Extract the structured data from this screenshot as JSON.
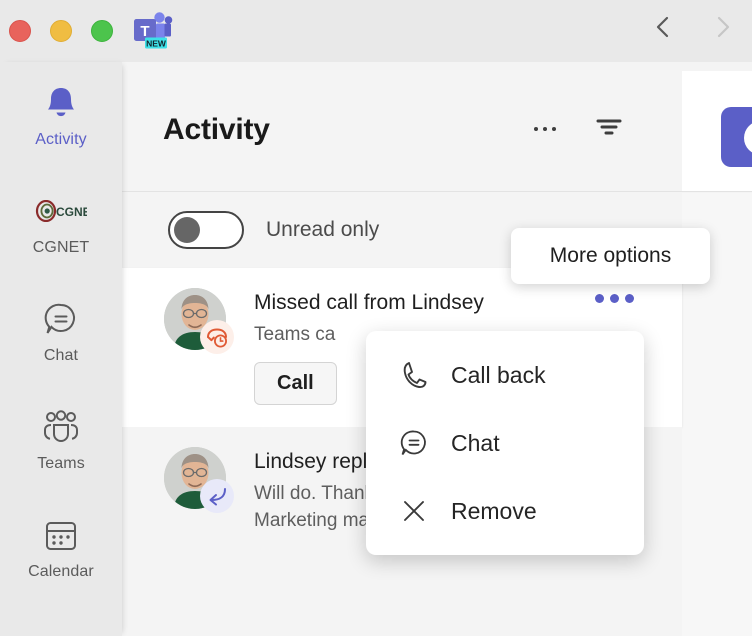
{
  "window": {
    "traffic_lights": [
      "close",
      "minimize",
      "maximize"
    ],
    "app_icon_name": "microsoft-teams-icon",
    "app_icon_badge": "NEW",
    "nav_back": "back",
    "nav_forward": "forward"
  },
  "sidebar": {
    "items": [
      {
        "label": "Activity",
        "icon": "bell-icon",
        "active": true
      },
      {
        "label": "CGNET",
        "icon": "cgnet-logo-icon",
        "active": false
      },
      {
        "label": "Chat",
        "icon": "chat-bubble-icon",
        "active": false
      },
      {
        "label": "Teams",
        "icon": "teams-people-icon",
        "active": false
      },
      {
        "label": "Calendar",
        "icon": "calendar-icon",
        "active": false
      }
    ]
  },
  "header": {
    "title": "Activity",
    "more_options_icon": "ellipsis-icon",
    "filter_icon": "filter-icon"
  },
  "filter_bar": {
    "toggle_label": "Unread only",
    "toggle_on": false
  },
  "tooltip": {
    "text": "More options"
  },
  "notifications": [
    {
      "title": "Missed call from Lindsey",
      "subtitle": "Teams ca",
      "action_label": "Call",
      "badge_icon": "missed-call-icon",
      "avatar_name": "user-avatar",
      "unread": true,
      "more_icon": "ellipsis-icon"
    },
    {
      "title": "Lindsey replied to...",
      "subtitle": "Will do.  Thanks",
      "subtitle2": "Marketing materials  >  Web A",
      "badge_icon": "reply-arrow-icon",
      "avatar_name": "user-avatar",
      "unread": false
    }
  ],
  "context_menu": {
    "items": [
      {
        "label": "Call back",
        "icon": "phone-icon"
      },
      {
        "label": "Chat",
        "icon": "chat-bubble-icon"
      },
      {
        "label": "Remove",
        "icon": "close-x-icon"
      }
    ]
  },
  "colors": {
    "accent": "#5b5fc7",
    "missed_call": "#e8604c",
    "window_bg": "#e9e9e9",
    "main_bg": "#f4f4f4"
  }
}
